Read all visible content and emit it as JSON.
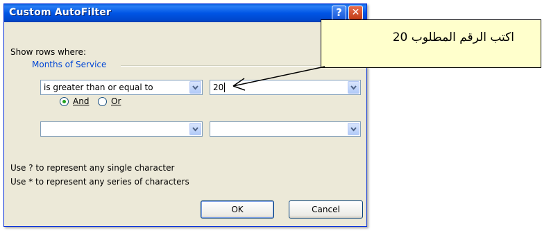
{
  "dialog": {
    "title": "Custom AutoFilter",
    "help_symbol": "?",
    "close_symbol": "✕",
    "show_rows_label": "Show rows where:",
    "group_label": "Months of Service",
    "row1": {
      "operator": "is greater than or equal to",
      "value": "20"
    },
    "row2": {
      "operator": "",
      "value": ""
    },
    "logic": {
      "and_label": "And",
      "or_label": "Or",
      "selected": "And"
    },
    "hint1": "Use ? to represent any single character",
    "hint2": "Use * to represent any series of characters",
    "ok_label": "OK",
    "cancel_label": "Cancel"
  },
  "callout": {
    "text": "اكتب الرقم المطلوب 20",
    "background": "#ffffcc"
  },
  "colors": {
    "title_bar": "#0055e5",
    "dialog_bg": "#ece9d8",
    "group_label": "#0046d5"
  }
}
